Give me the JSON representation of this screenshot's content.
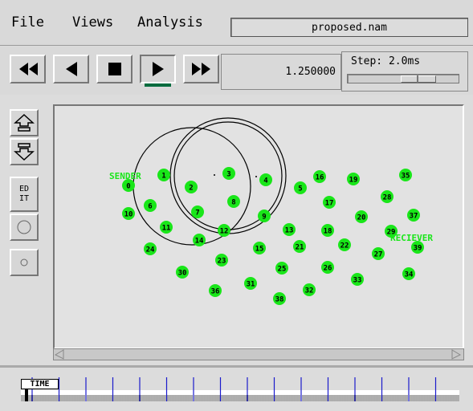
{
  "menu": {
    "file": "File",
    "views": "Views",
    "analysis": "Analysis",
    "filename": "proposed.nam"
  },
  "toolbar": {
    "current_time": "1.250000",
    "step_label": "Step: 2.0ms"
  },
  "left_tools": {
    "edit_label_line1": "ED",
    "edit_label_line2": "IT"
  },
  "timeline": {
    "label": "TIME"
  },
  "colors": {
    "node_fill": "#19e619",
    "node_text": "#000000",
    "label_green": "#19e619",
    "canvas_bg": "#e2e2e2"
  },
  "network": {
    "sender_label": "SENDER",
    "receiver_label": "RECIEVER",
    "nodes": [
      "0",
      "1",
      "2",
      "3",
      "4",
      "5",
      "6",
      "7",
      "8",
      "9",
      "10",
      "11",
      "12",
      "13",
      "14",
      "15",
      "16",
      "17",
      "18",
      "19",
      "20",
      "21",
      "22",
      "23",
      "24",
      "25",
      "26",
      "27",
      "28",
      "29",
      "30",
      "31",
      "32",
      "33",
      "34",
      "35",
      "36",
      "37",
      "38",
      "39"
    ]
  }
}
